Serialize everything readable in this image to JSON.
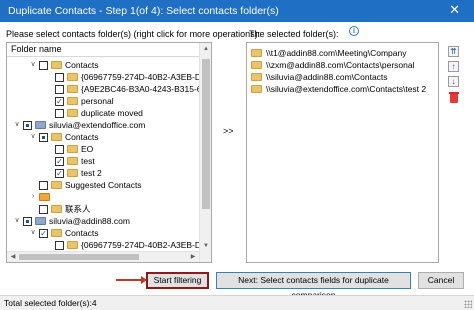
{
  "window": {
    "title": "Duplicate Contacts - Step 1(of 4): Select contacts folder(s)",
    "close_glyph": "✕"
  },
  "left_panel": {
    "instruction": "Please select contacts folder(s) (right click for more operations):",
    "column_header": "Folder name",
    "tree": [
      {
        "label": "Contacts",
        "level": 1,
        "toggle": "∨",
        "check": "unchecked",
        "icon": "contacts-folder"
      },
      {
        "label": "{06967759-274D-40B2-A3EB-D",
        "level": 2,
        "toggle": "",
        "check": "unchecked",
        "icon": "folder"
      },
      {
        "label": "{A9E2BC46-B3A0-4243-B315-6",
        "level": 2,
        "toggle": "",
        "check": "unchecked",
        "icon": "folder"
      },
      {
        "label": "personal",
        "level": 2,
        "toggle": "",
        "check": "checked",
        "icon": "folder"
      },
      {
        "label": "duplicate moved",
        "level": 2,
        "toggle": "",
        "check": "unchecked",
        "icon": "folder"
      },
      {
        "label": "siluvia@extendoffice.com",
        "level": 0,
        "toggle": "∨",
        "check": "partial",
        "icon": "account"
      },
      {
        "label": "Contacts",
        "level": 1,
        "toggle": "∨",
        "check": "partial",
        "icon": "contacts-folder"
      },
      {
        "label": "EO",
        "level": 2,
        "toggle": "",
        "check": "unchecked",
        "icon": "folder"
      },
      {
        "label": "test",
        "level": 2,
        "toggle": "",
        "check": "checked",
        "icon": "folder"
      },
      {
        "label": "test 2",
        "level": 2,
        "toggle": "",
        "check": "checked",
        "icon": "folder"
      },
      {
        "label": "Suggested Contacts",
        "level": 1,
        "toggle": "",
        "check": "unchecked",
        "icon": "contacts-folder"
      },
      {
        "label": "",
        "level": 1,
        "toggle": "›",
        "check": "",
        "icon": "orange-folder"
      },
      {
        "label": "联系人",
        "level": 1,
        "toggle": "",
        "check": "unchecked",
        "icon": "contacts-folder"
      },
      {
        "label": "siluvia@addin88.com",
        "level": 0,
        "toggle": "∨",
        "check": "partial",
        "icon": "account"
      },
      {
        "label": "Contacts",
        "level": 1,
        "toggle": "∨",
        "check": "checked",
        "icon": "contacts-folder"
      },
      {
        "label": "{06967759-274D-40B2-A3EB-D",
        "level": 2,
        "toggle": "",
        "check": "unchecked",
        "icon": "folder"
      },
      {
        "label": "{A9E2BC46-B3A0-4243-B315-6",
        "level": 2,
        "toggle": "",
        "check": "unchecked",
        "icon": "folder"
      }
    ]
  },
  "middle": {
    "move_label": ">>"
  },
  "right_panel": {
    "label": "The selected folder(s):",
    "info_glyph": "i",
    "items": [
      "\\\\t1@addin88.com\\Meeting\\Company",
      "\\\\zxm@addin88.com\\Contacts\\personal",
      "\\\\siluvia@addin88.com\\Contacts",
      "\\\\siluvia@extendoffice.com\\Contacts\\test 2"
    ],
    "buttons": {
      "top": "⇈",
      "up": "↑",
      "down": "↓",
      "delete": "delete-icon"
    }
  },
  "footer": {
    "start_label": "Start filtering",
    "next_label": "Next: Select contacts fields for duplicate comparison",
    "cancel_label": "Cancel"
  },
  "status": {
    "text": "Total selected folder(s):4"
  },
  "colors": {
    "titlebar": "#1f6fc5",
    "start_border": "#8b1a1a",
    "arrow": "#c0392b",
    "folder": "#e9c46a"
  }
}
